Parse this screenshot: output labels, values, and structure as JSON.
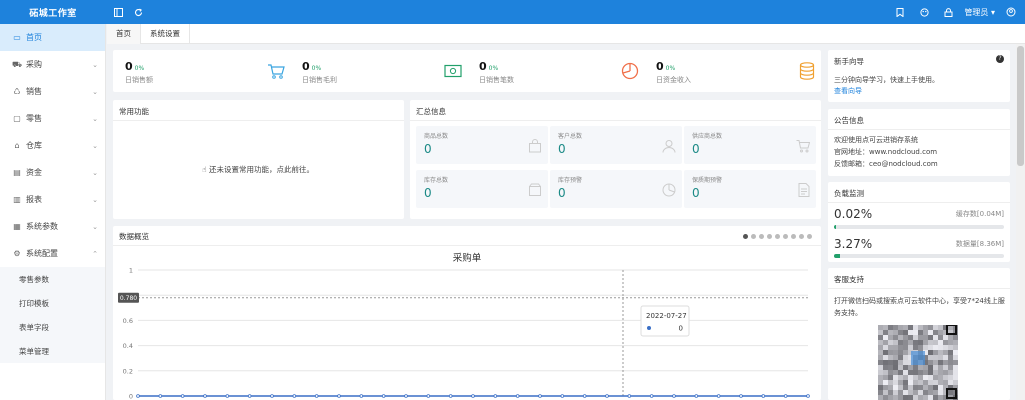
{
  "app": {
    "title": "砳城工作室"
  },
  "topbar": {
    "icons": [
      "menu-icon",
      "refresh-icon",
      "bookmark-icon",
      "skin-icon",
      "lock-icon",
      "user-icon"
    ],
    "user_label": "管理员"
  },
  "sidebar": {
    "items": [
      {
        "label": "首页",
        "icon": "monitor-icon",
        "active": true
      },
      {
        "label": "采购",
        "icon": "cart-icon"
      },
      {
        "label": "销售",
        "icon": "sale-icon"
      },
      {
        "label": "零售",
        "icon": "bag-icon"
      },
      {
        "label": "仓库",
        "icon": "warehouse-icon"
      },
      {
        "label": "资金",
        "icon": "money-icon"
      },
      {
        "label": "报表",
        "icon": "report-icon"
      },
      {
        "label": "系统参数",
        "icon": "grid-icon"
      },
      {
        "label": "系统配置",
        "icon": "gear-icon",
        "expanded": true
      }
    ],
    "subitems": [
      "零售参数",
      "打印模板",
      "表单字段",
      "菜单管理"
    ]
  },
  "tabs": [
    {
      "label": "首页",
      "active": true
    },
    {
      "label": "系统设置"
    }
  ],
  "stats": [
    {
      "value": "0",
      "pct": "0%",
      "label": "日销售额",
      "icon": "cart-icon"
    },
    {
      "value": "0",
      "pct": "0%",
      "label": "日销售毛利",
      "icon": "cash-icon"
    },
    {
      "value": "0",
      "pct": "0%",
      "label": "日销售笔数",
      "icon": "bag-icon"
    },
    {
      "value": "0",
      "pct": "0%",
      "label": "日资金收入",
      "icon": "coins-icon"
    }
  ],
  "common": {
    "title": "常用功能",
    "tip": "还未设置常用功能，点此前往。"
  },
  "summary": {
    "title": "汇总信息",
    "boxes": [
      {
        "label": "商品总数",
        "value": "0"
      },
      {
        "label": "客户总数",
        "value": "0"
      },
      {
        "label": "供应商总数",
        "value": "0"
      },
      {
        "label": "库存总数",
        "value": "0"
      },
      {
        "label": "库存预警",
        "value": "0"
      },
      {
        "label": "保质期预警",
        "value": "0"
      }
    ]
  },
  "overview": {
    "title": "数据概览",
    "chart_title": "采购单",
    "crosshair_value": "0.780",
    "tooltip_date": "2022-07-27",
    "tooltip_value": "0",
    "carousel_count": 9,
    "carousel_active": 0
  },
  "chart_data": {
    "type": "line",
    "title": "采购单",
    "xlabel": "",
    "ylabel": "",
    "ylim": [
      0,
      1
    ],
    "yticks": [
      "1",
      "0.8",
      "0.6",
      "0.4",
      "0.2",
      "0"
    ],
    "x": [
      "2022-07-27"
    ],
    "values": [
      0
    ],
    "grid": true,
    "colors": {
      "line": "#3a6fc6"
    }
  },
  "guide": {
    "title": "新手向导",
    "text": "三分钟向导学习，快速上手使用。",
    "link": "查看向导"
  },
  "notice": {
    "title": "公告信息",
    "lines": [
      "欢迎使用点可云进销存系统",
      "官网地址：www.nodcloud.com",
      "反馈邮箱：ceo@nodcloud.com"
    ]
  },
  "load": {
    "title": "负载监测",
    "cache": {
      "pct": "0.02%",
      "label": "缓存数[0.04M]",
      "fraction": 0.0002
    },
    "data": {
      "pct": "3.27%",
      "label": "数据量[8.36M]",
      "fraction": 0.0327
    }
  },
  "support": {
    "title": "客服支持",
    "text": "打开微信扫码或搜索点可云软件中心，享受7*24线上服务支持。"
  },
  "colors": {
    "primary": "#1e82dc",
    "success": "#22a06b",
    "value": "#1b8a86"
  }
}
